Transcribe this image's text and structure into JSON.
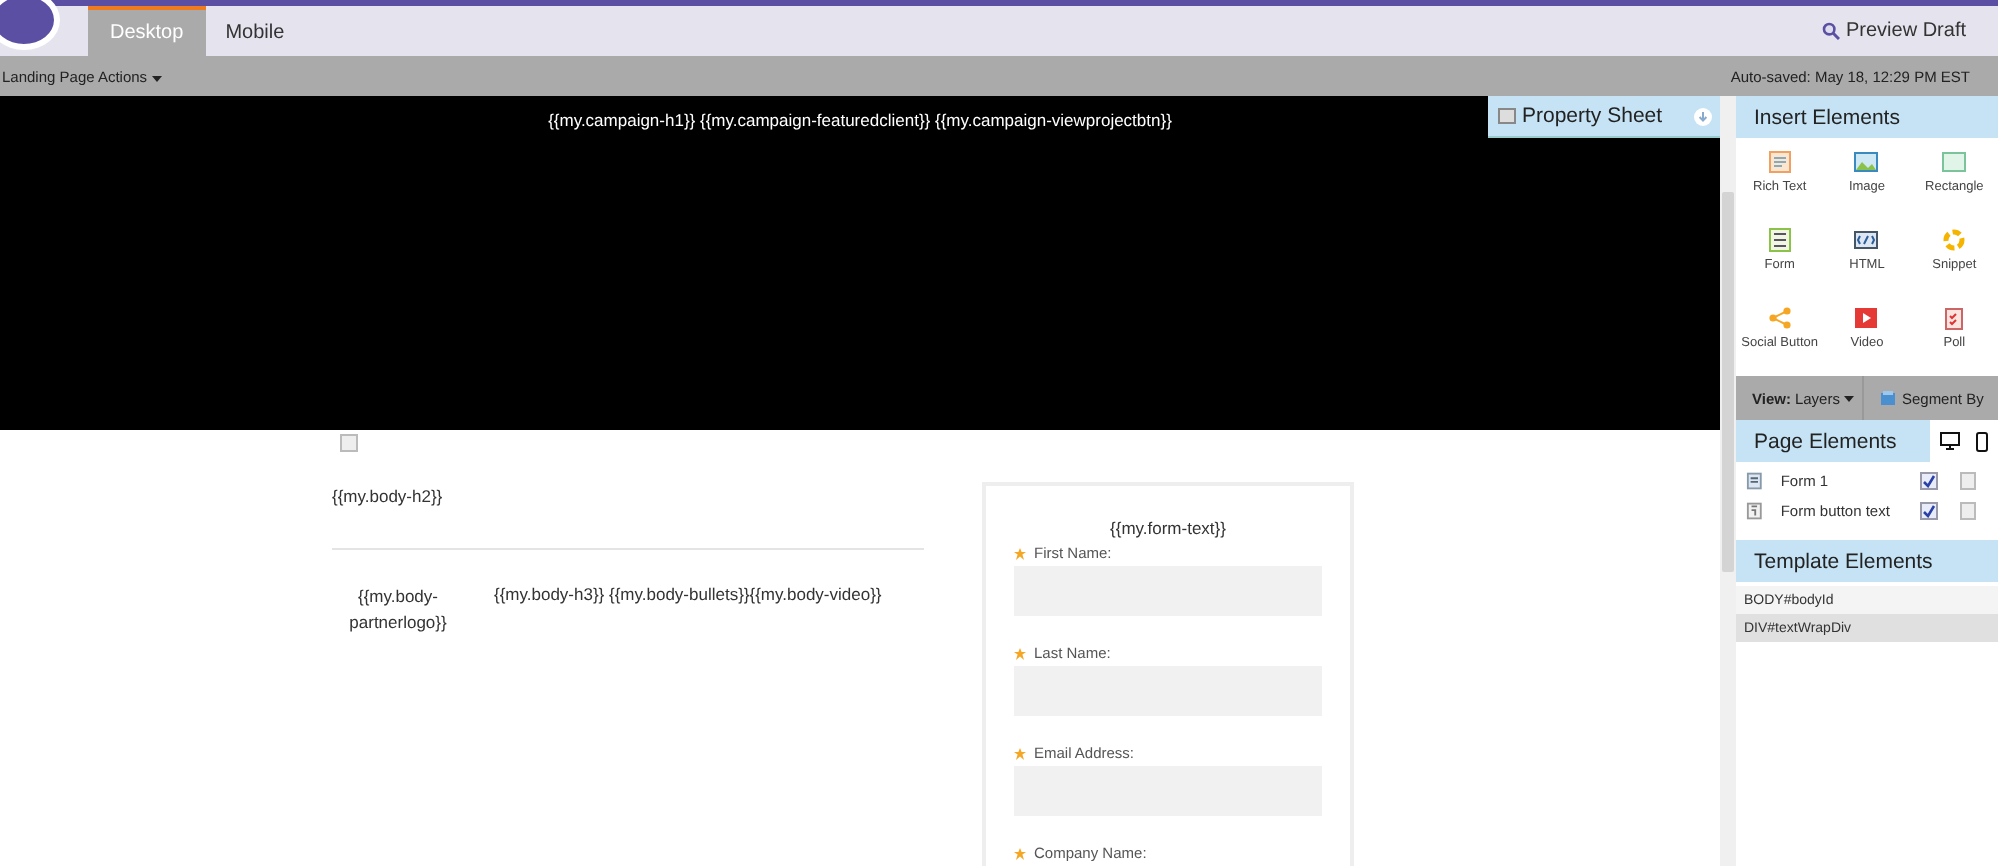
{
  "tabs": [
    {
      "label": "Desktop",
      "selected": true
    },
    {
      "label": "Mobile",
      "selected": false
    }
  ],
  "preview_button": "Preview Draft",
  "actions_menu": "Landing Page Actions",
  "autosave": "Auto-saved: May 18, 12:29 PM EST",
  "hero": {
    "text": "{{my.campaign-h1}} {{my.campaign-featuredclient}} {{my.campaign-viewprojectbtn}}"
  },
  "body": {
    "checkbox_checked": false,
    "h2": "{{my.body-h2}}",
    "partnerlogo": "{{my.body-partnerlogo}}",
    "content": "{{my.body-h3}} {{my.body-bullets}}{{my.body-video}}"
  },
  "form": {
    "title": "{{my.form-text}}",
    "fields": [
      {
        "label": "First Name:",
        "required": true
      },
      {
        "label": "Last Name:",
        "required": true
      },
      {
        "label": "Email Address:",
        "required": true
      },
      {
        "label": "Company Name:",
        "required": true
      }
    ]
  },
  "property_sheet": {
    "title": "Property Sheet"
  },
  "insert_elements": {
    "title": "Insert Elements",
    "items": [
      {
        "kind": "richtext",
        "label": "Rich Text"
      },
      {
        "kind": "image",
        "label": "Image"
      },
      {
        "kind": "rectangle",
        "label": "Rectangle"
      },
      {
        "kind": "form",
        "label": "Form"
      },
      {
        "kind": "html",
        "label": "HTML"
      },
      {
        "kind": "snippet",
        "label": "Snippet"
      },
      {
        "kind": "social",
        "label": "Social Button"
      },
      {
        "kind": "video",
        "label": "Video"
      },
      {
        "kind": "poll",
        "label": "Poll"
      }
    ]
  },
  "view_bar": {
    "view_label": "View:",
    "view_value": "Layers",
    "segment": "Segment By"
  },
  "page_elements": {
    "title": "Page Elements",
    "items": [
      {
        "kind": "form",
        "label": "Form 1",
        "desktop": true,
        "mobile": false
      },
      {
        "kind": "button",
        "label": "Form button text",
        "desktop": true,
        "mobile": false
      }
    ]
  },
  "template_elements": {
    "title": "Template Elements",
    "items": [
      {
        "label": "BODY#bodyId",
        "selected": false
      },
      {
        "label": "DIV#textWrapDiv",
        "selected": true
      }
    ]
  }
}
